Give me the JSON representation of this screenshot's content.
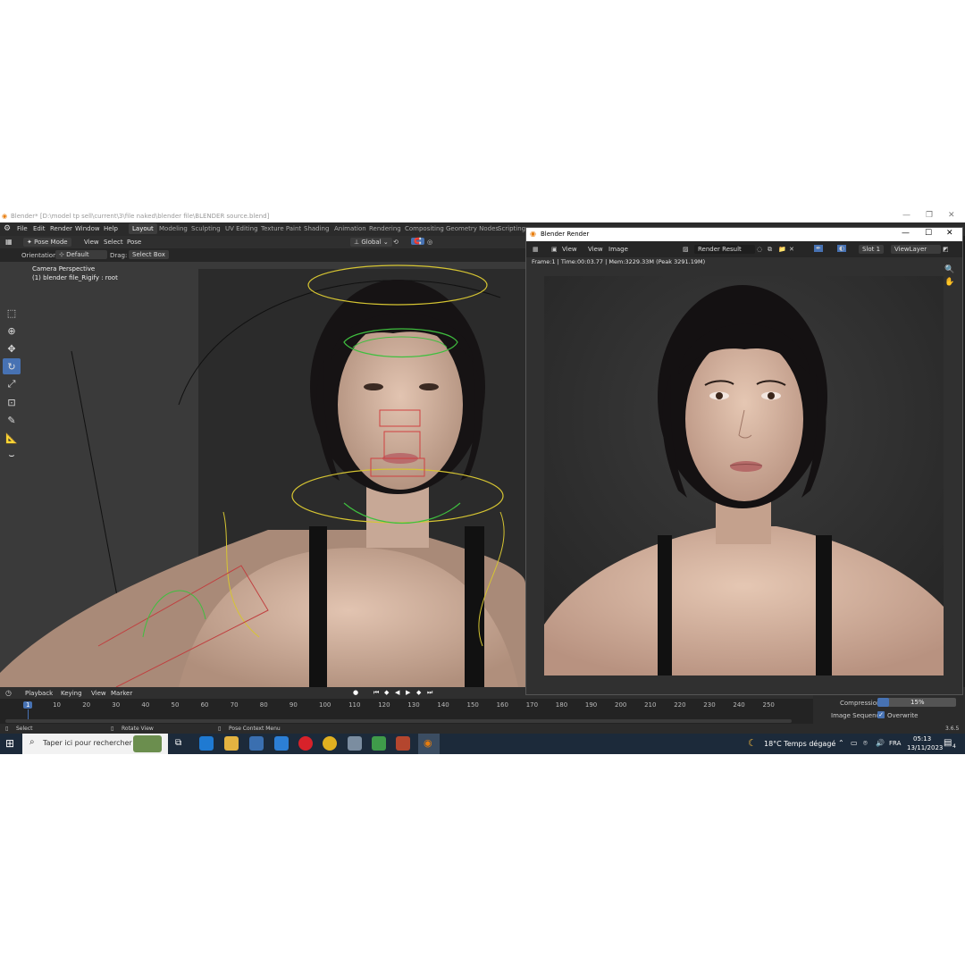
{
  "window": {
    "title": "Blender* [D:\\model tp sell\\current\\3\\file naked\\blender file\\BLENDER source.blend]",
    "controls": {
      "minimize": "—",
      "maximize": "❐",
      "close": "✕"
    }
  },
  "menu": {
    "items": [
      "File",
      "Edit",
      "Render",
      "Window",
      "Help"
    ],
    "workspaces": [
      "Layout",
      "Modeling",
      "Sculpting",
      "UV Editing",
      "Texture Paint",
      "Shading",
      "Animation",
      "Rendering",
      "Compositing",
      "Geometry Nodes",
      "Scripting"
    ],
    "active_workspace": "Layout"
  },
  "viewport_header": {
    "mode": "Pose Mode",
    "menus": [
      "View",
      "Select",
      "Pose"
    ],
    "transform_orientation": "Global",
    "orientation_label": "Orientation:",
    "orientation_value": "Default",
    "drag_label": "Drag:",
    "drag_value": "Select Box"
  },
  "viewport": {
    "camera_label": "Camera Perspective",
    "object_label": "(1) blender file_Rigify : root"
  },
  "toolbar": {
    "tools": [
      "select-box-icon",
      "cursor-icon",
      "move-icon",
      "rotate-icon",
      "scale-icon",
      "transform-icon",
      "annotate-icon",
      "measure-icon",
      "relax-pose-icon"
    ],
    "active_index": 3
  },
  "render_window": {
    "title": "Blender Render",
    "controls": {
      "minimize": "—",
      "maximize": "☐",
      "close": "✕"
    },
    "menus": [
      "View",
      "View",
      "Image"
    ],
    "image_name": "Render Result",
    "slot": "Slot 1",
    "view_layer": "ViewLayer",
    "info": "Frame:1 | Time:00:03.77 | Mem:3229.33M (Peak 3291.19M)"
  },
  "timeline": {
    "menus": [
      "Playback",
      "Keying",
      "View",
      "Marker"
    ],
    "current_frame": "1",
    "ticks": [
      "10",
      "20",
      "30",
      "40",
      "50",
      "60",
      "70",
      "80",
      "90",
      "100",
      "110",
      "120",
      "130",
      "140",
      "150",
      "160",
      "170",
      "180",
      "190",
      "200",
      "210",
      "220",
      "230",
      "240",
      "250"
    ]
  },
  "properties": {
    "compression_label": "Compression",
    "compression_value": "15%",
    "compression_fraction": 0.15,
    "image_sequence_label": "Image Sequence",
    "overwrite_label": "Overwrite",
    "overwrite_checked": true
  },
  "statusbar": {
    "left": "Select",
    "middle": "Rotate View",
    "right_hint": "Pose Context Menu",
    "version": "3.6.5"
  },
  "taskbar": {
    "search_placeholder": "Taper ici pour rechercher",
    "weather": "18°C  Temps dégagé",
    "language": "FRA",
    "time": "05:13",
    "date": "13/11/2023",
    "notifications": "4"
  },
  "colors": {
    "accent": "#4772b3",
    "viewport_bg": "#3a3a3a",
    "header_bg": "#2b2b2b",
    "taskbar_bg": "#1c2a3a"
  }
}
